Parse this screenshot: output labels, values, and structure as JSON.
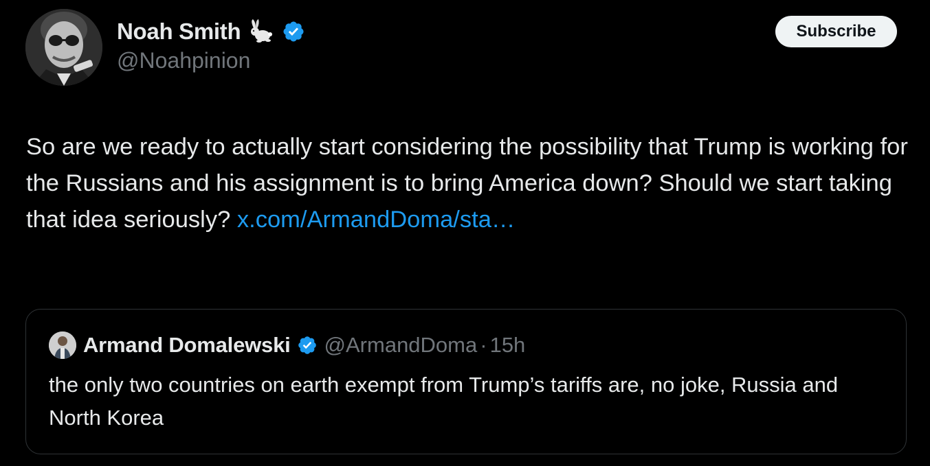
{
  "post": {
    "author": {
      "name": "Noah Smith",
      "handle": "@Noahpinion",
      "name_emoji": "rabbit-icon",
      "verified": true
    },
    "subscribe_label": "Subscribe",
    "text": "So are we ready to actually start considering the possibility that Trump is working for the Russians and his assignment is to bring America down? Should we start taking that idea seriously?",
    "link_text": "x.com/ArmandDoma/sta…",
    "quote": {
      "author_name": "Armand Domalewski",
      "handle": "@ArmandDoma",
      "separator": "·",
      "time": "15h",
      "verified": true,
      "text": "the only two countries on earth exempt from Trump’s tariffs are, no joke, Russia and North Korea"
    }
  },
  "colors": {
    "background": "#000000",
    "text_primary": "#e7e9ea",
    "text_secondary": "#71767b",
    "link": "#1d9bf0",
    "verified": "#1d9bf0",
    "button_bg": "#eff3f4",
    "button_text": "#0f1419",
    "border": "#2f3336"
  }
}
